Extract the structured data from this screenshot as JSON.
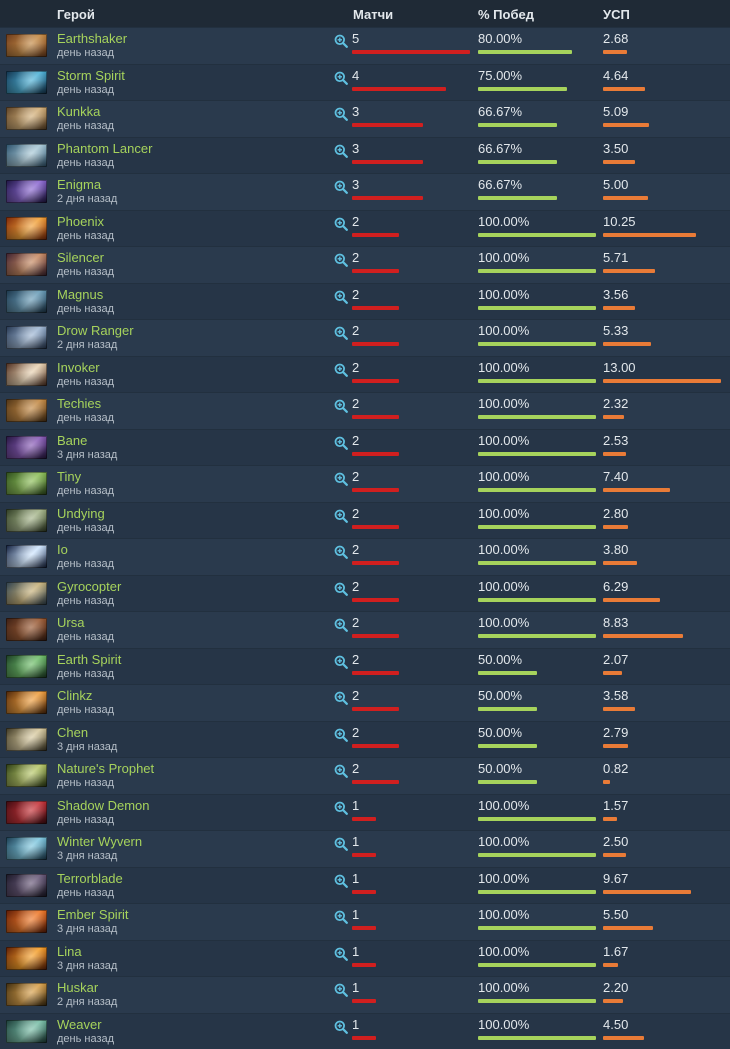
{
  "header": {
    "hero": "Герой",
    "matches": "Матчи",
    "winrate": "% Побед",
    "kda": "УСП"
  },
  "colors": {
    "matches_bar": "#d11f1f",
    "win_bar": "#a6d35c",
    "kda_bar": "#e97b37",
    "hero_name": "#a6d35c"
  },
  "scale": {
    "matches_max": 5,
    "win_max": 100,
    "kda_max": 13
  },
  "rows": [
    {
      "name": "Earthshaker",
      "time": "день назад",
      "matches": 5,
      "win": "80.00%",
      "win_pct": 80,
      "kda": "2.68",
      "kda_num": 2.68,
      "portrait": [
        "#6b3a1c",
        "#c48a45"
      ]
    },
    {
      "name": "Storm Spirit",
      "time": "день назад",
      "matches": 4,
      "win": "75.00%",
      "win_pct": 75,
      "kda": "4.64",
      "kda_num": 4.64,
      "portrait": [
        "#11304a",
        "#4fb3d8"
      ]
    },
    {
      "name": "Kunkka",
      "time": "день назад",
      "matches": 3,
      "win": "66.67%",
      "win_pct": 66.67,
      "kda": "5.09",
      "kda_num": 5.09,
      "portrait": [
        "#5a4025",
        "#d3b07a"
      ]
    },
    {
      "name": "Phantom Lancer",
      "time": "день назад",
      "matches": 3,
      "win": "66.67%",
      "win_pct": 66.67,
      "kda": "3.50",
      "kda_num": 3.5,
      "portrait": [
        "#2a4f69",
        "#a8c8d6"
      ]
    },
    {
      "name": "Enigma",
      "time": "2 дня назад",
      "matches": 3,
      "win": "66.67%",
      "win_pct": 66.67,
      "kda": "5.00",
      "kda_num": 5.0,
      "portrait": [
        "#1c1440",
        "#8d6ad3"
      ]
    },
    {
      "name": "Phoenix",
      "time": "день назад",
      "matches": 2,
      "win": "100.00%",
      "win_pct": 100,
      "kda": "10.25",
      "kda_num": 10.25,
      "portrait": [
        "#7a2508",
        "#f2a23a"
      ]
    },
    {
      "name": "Silencer",
      "time": "день назад",
      "matches": 2,
      "win": "100.00%",
      "win_pct": 100,
      "kda": "5.71",
      "kda_num": 5.71,
      "portrait": [
        "#3a2030",
        "#c78a62"
      ]
    },
    {
      "name": "Magnus",
      "time": "день назад",
      "matches": 2,
      "win": "100.00%",
      "win_pct": 100,
      "kda": "3.56",
      "kda_num": 3.56,
      "portrait": [
        "#1a3347",
        "#6a9db8"
      ]
    },
    {
      "name": "Drow Ranger",
      "time": "2 дня назад",
      "matches": 2,
      "win": "100.00%",
      "win_pct": 100,
      "kda": "5.33",
      "kda_num": 5.33,
      "portrait": [
        "#23344e",
        "#9fb7d4"
      ]
    },
    {
      "name": "Invoker",
      "time": "день назад",
      "matches": 2,
      "win": "100.00%",
      "win_pct": 100,
      "kda": "13.00",
      "kda_num": 13.0,
      "portrait": [
        "#4a2b1e",
        "#e8d2b2"
      ]
    },
    {
      "name": "Techies",
      "time": "день назад",
      "matches": 2,
      "win": "100.00%",
      "win_pct": 100,
      "kda": "2.32",
      "kda_num": 2.32,
      "portrait": [
        "#4c3216",
        "#c48a45"
      ]
    },
    {
      "name": "Bane",
      "time": "3 дня назад",
      "matches": 2,
      "win": "100.00%",
      "win_pct": 100,
      "kda": "2.53",
      "kda_num": 2.53,
      "portrait": [
        "#24163e",
        "#8a5db8"
      ]
    },
    {
      "name": "Tiny",
      "time": "день назад",
      "matches": 2,
      "win": "100.00%",
      "win_pct": 100,
      "kda": "7.40",
      "kda_num": 7.4,
      "portrait": [
        "#2c4a1c",
        "#8ec05a"
      ]
    },
    {
      "name": "Undying",
      "time": "день назад",
      "matches": 2,
      "win": "100.00%",
      "win_pct": 100,
      "kda": "2.80",
      "kda_num": 2.8,
      "portrait": [
        "#2d3a22",
        "#a5b58a"
      ]
    },
    {
      "name": "Io",
      "time": "день назад",
      "matches": 2,
      "win": "100.00%",
      "win_pct": 100,
      "kda": "3.80",
      "kda_num": 3.8,
      "portrait": [
        "#0f1c3a",
        "#cfe6ff"
      ]
    },
    {
      "name": "Gyrocopter",
      "time": "день назад",
      "matches": 2,
      "win": "100.00%",
      "win_pct": 100,
      "kda": "6.29",
      "kda_num": 6.29,
      "portrait": [
        "#2a3e4e",
        "#c8b27a"
      ]
    },
    {
      "name": "Ursa",
      "time": "день назад",
      "matches": 2,
      "win": "100.00%",
      "win_pct": 100,
      "kda": "8.83",
      "kda_num": 8.83,
      "portrait": [
        "#3a1f14",
        "#9a5a34"
      ]
    },
    {
      "name": "Earth Spirit",
      "time": "день назад",
      "matches": 2,
      "win": "50.00%",
      "win_pct": 50,
      "kda": "2.07",
      "kda_num": 2.07,
      "portrait": [
        "#1b3a24",
        "#6fbf6a"
      ]
    },
    {
      "name": "Clinkz",
      "time": "день назад",
      "matches": 2,
      "win": "50.00%",
      "win_pct": 50,
      "kda": "3.58",
      "kda_num": 3.58,
      "portrait": [
        "#4a2408",
        "#f0a040"
      ]
    },
    {
      "name": "Chen",
      "time": "3 дня назад",
      "matches": 2,
      "win": "50.00%",
      "win_pct": 50,
      "kda": "2.79",
      "kda_num": 2.79,
      "portrait": [
        "#3a3522",
        "#d8caa0"
      ]
    },
    {
      "name": "Nature's Prophet",
      "time": "день назад",
      "matches": 2,
      "win": "50.00%",
      "win_pct": 50,
      "kda": "0.82",
      "kda_num": 0.82,
      "portrait": [
        "#2a3a14",
        "#b8c86a"
      ]
    },
    {
      "name": "Shadow Demon",
      "time": "день назад",
      "matches": 1,
      "win": "100.00%",
      "win_pct": 100,
      "kda": "1.57",
      "kda_num": 1.57,
      "portrait": [
        "#3a0a10",
        "#c8343a"
      ]
    },
    {
      "name": "Winter Wyvern",
      "time": "3 дня назад",
      "matches": 1,
      "win": "100.00%",
      "win_pct": 100,
      "kda": "2.50",
      "kda_num": 2.5,
      "portrait": [
        "#1a3a4e",
        "#7fc8e0"
      ]
    },
    {
      "name": "Terrorblade",
      "time": "день назад",
      "matches": 1,
      "win": "100.00%",
      "win_pct": 100,
      "kda": "9.67",
      "kda_num": 9.67,
      "portrait": [
        "#1a1826",
        "#6a5a7a"
      ]
    },
    {
      "name": "Ember Spirit",
      "time": "3 дня назад",
      "matches": 1,
      "win": "100.00%",
      "win_pct": 100,
      "kda": "5.50",
      "kda_num": 5.5,
      "portrait": [
        "#5a1a06",
        "#f07a2a"
      ]
    },
    {
      "name": "Lina",
      "time": "3 дня назад",
      "matches": 1,
      "win": "100.00%",
      "win_pct": 100,
      "kda": "1.67",
      "kda_num": 1.67,
      "portrait": [
        "#5a1c06",
        "#f6a02a"
      ]
    },
    {
      "name": "Huskar",
      "time": "2 дня назад",
      "matches": 1,
      "win": "100.00%",
      "win_pct": 100,
      "kda": "2.20",
      "kda_num": 2.2,
      "portrait": [
        "#3a2a10",
        "#d8a04a"
      ]
    },
    {
      "name": "Weaver",
      "time": "день назад",
      "matches": 1,
      "win": "100.00%",
      "win_pct": 100,
      "kda": "4.50",
      "kda_num": 4.5,
      "portrait": [
        "#1a3a36",
        "#7abfa8"
      ]
    }
  ]
}
